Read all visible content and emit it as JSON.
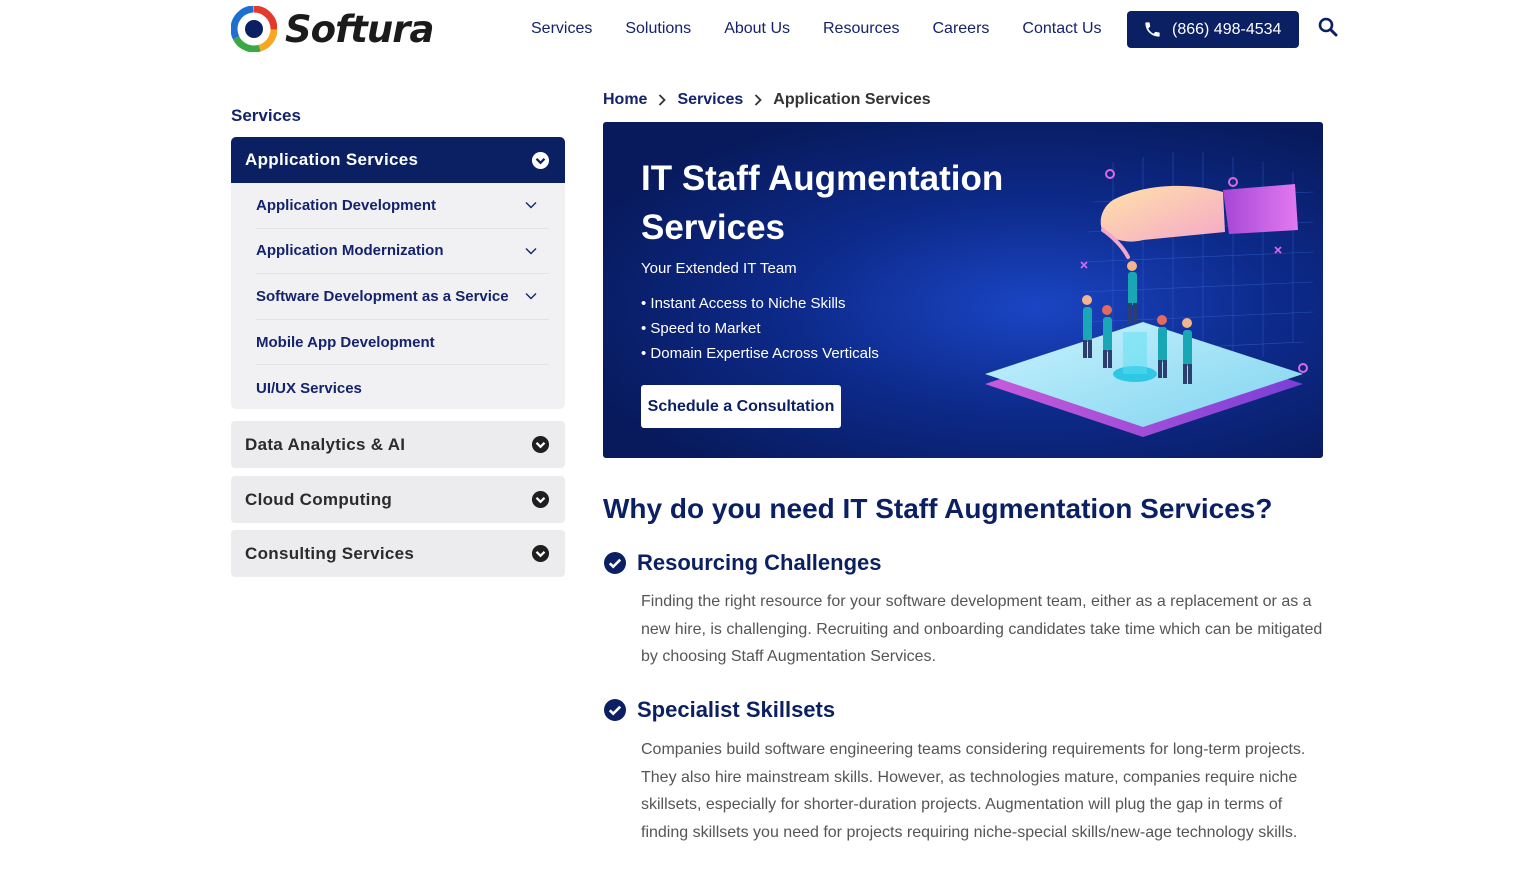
{
  "header": {
    "logo_text": "Softura",
    "nav": [
      "Services",
      "Solutions",
      "About Us",
      "Resources",
      "Careers",
      "Contact Us"
    ],
    "phone": "(866) 498-4534",
    "icons": {
      "phone": "phone-icon",
      "search": "search-icon"
    }
  },
  "breadcrumb": [
    "Home",
    "Services",
    "Application Services"
  ],
  "sidebar": {
    "title": "Services",
    "active": "Application Services",
    "sub_items": [
      {
        "label": "Application Development",
        "expandable": true
      },
      {
        "label": "Application Modernization",
        "expandable": true
      },
      {
        "label": "Software Development as a Service",
        "expandable": true
      },
      {
        "label": "Mobile App Development",
        "expandable": false
      },
      {
        "label": "UI/UX Services",
        "expandable": false
      }
    ],
    "categories": [
      "Data Analytics & AI",
      "Cloud Computing",
      "Consulting Services"
    ]
  },
  "hero": {
    "title": "IT Staff Augmentation Services",
    "subtitle": "Your Extended IT Team",
    "bullets": [
      "• Instant Access to Niche Skills",
      "• Speed to Market",
      "• Domain Expertise Across Verticals"
    ],
    "cta": "Schedule a Consultation"
  },
  "content": {
    "heading": "Why do you need IT Staff Augmentation Services?",
    "sections": [
      {
        "title": "Resourcing Challenges",
        "body": "Finding the right resource for your software development team, either as a replacement or as a new hire, is challenging. Recruiting and onboarding candidates take time which can be mitigated by choosing Staff Augmentation Services."
      },
      {
        "title": "Specialist Skillsets",
        "body": "Companies build software engineering teams considering requirements for long-term projects. They also hire mainstream skills. However, as technologies mature, companies require niche skillsets, especially for shorter-duration projects. Augmentation will plug the gap in terms of finding skillsets you need for projects requiring niche-special skills/new-age technology skills."
      }
    ]
  },
  "colors": {
    "brand_navy": "#0b1f63",
    "link_navy": "#14236b",
    "sidebar_bg": "#f1f1f4",
    "body_text": "#555555"
  }
}
